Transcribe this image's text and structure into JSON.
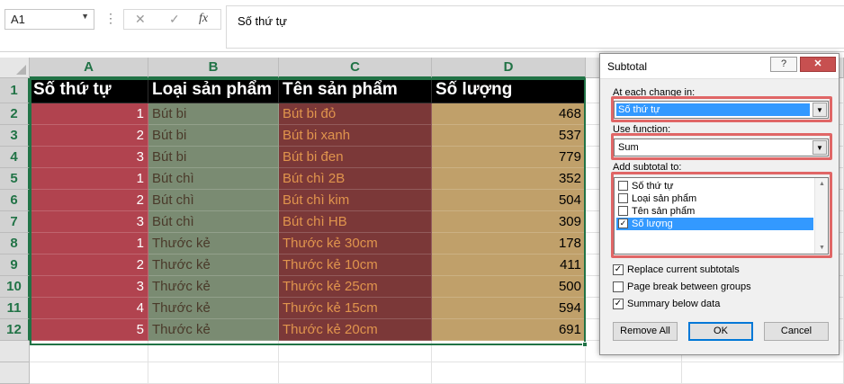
{
  "formula_bar": {
    "name_box": "A1",
    "dots": "⋮",
    "cancel_icon": "✕",
    "enter_icon": "✓",
    "fx_label": "fx",
    "formula": "Số thứ tự"
  },
  "sheet": {
    "columns": [
      "A",
      "B",
      "C",
      "D"
    ],
    "rows": [
      "1",
      "2",
      "3",
      "4",
      "5",
      "6",
      "7",
      "8",
      "9",
      "10",
      "11",
      "12"
    ],
    "header": [
      "Số thứ tự",
      "Loại sản phẩm",
      "Tên sản phẩm",
      "Số lượng"
    ],
    "data": [
      [
        "1",
        "Bút bi",
        "Bút bi đỏ",
        "468"
      ],
      [
        "2",
        "Bút bi",
        "Bút bi xanh",
        "537"
      ],
      [
        "3",
        "Bút bi",
        "Bút bi đen",
        "779"
      ],
      [
        "1",
        "Bút chì",
        "Bút chì 2B",
        "352"
      ],
      [
        "2",
        "Bút chì",
        "Bút chì kim",
        "504"
      ],
      [
        "3",
        "Bút chì",
        "Bút chì HB",
        "309"
      ],
      [
        "1",
        "Thước kẻ",
        "Thước kẻ 30cm",
        "178"
      ],
      [
        "2",
        "Thước kẻ",
        "Thước kẻ 10cm",
        "411"
      ],
      [
        "3",
        "Thước kẻ",
        "Thước kẻ 25cm",
        "500"
      ],
      [
        "4",
        "Thước kẻ",
        "Thước kẻ 15cm",
        "594"
      ],
      [
        "5",
        "Thước kẻ",
        "Thước kẻ 20cm",
        "691"
      ]
    ],
    "colors": {
      "col_a": "#b1434f",
      "col_b": "#7a8b72",
      "col_c": "#7b3838",
      "col_d": "#c0a06a",
      "accent": "#217346"
    }
  },
  "dialog": {
    "title": "Subtotal",
    "help_btn": "?",
    "close_btn": "✕",
    "at_each_change_label": "At each change in:",
    "at_each_change_value": "Số thứ tự",
    "use_function_label": "Use function:",
    "use_function_value": "Sum",
    "add_subtotal_label": "Add subtotal to:",
    "add_subtotal_items": [
      {
        "label": "Số thứ tự",
        "checked": false
      },
      {
        "label": "Loại sản phẩm",
        "checked": false
      },
      {
        "label": "Tên sản phẩm",
        "checked": false
      },
      {
        "label": "Số lượng",
        "checked": true
      }
    ],
    "replace_label": "Replace current subtotals",
    "replace_checked": true,
    "page_break_label": "Page break between groups",
    "page_break_checked": false,
    "summary_label": "Summary below data",
    "summary_checked": true,
    "remove_all": "Remove All",
    "ok": "OK",
    "cancel": "Cancel",
    "highlight_color": "#e06666"
  }
}
